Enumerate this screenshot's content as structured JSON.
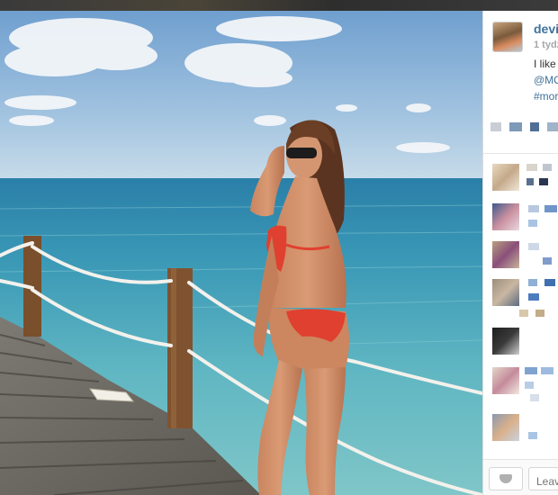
{
  "post": {
    "username": "devi",
    "time_ago": "1 tydz",
    "caption_line1": "I like",
    "caption_mention": "@MO",
    "caption_hashtag": "#mor"
  },
  "comment_box": {
    "placeholder": "Leave"
  },
  "icons": {
    "like": "heart-icon",
    "avatar": "user-avatar"
  },
  "colors": {
    "link": "#3f729b",
    "username": "#3f729b",
    "muted": "#a5a7aa",
    "sky": "#8fb8d8",
    "sea": "#3fa0b8",
    "bikini": "#e0402f"
  }
}
